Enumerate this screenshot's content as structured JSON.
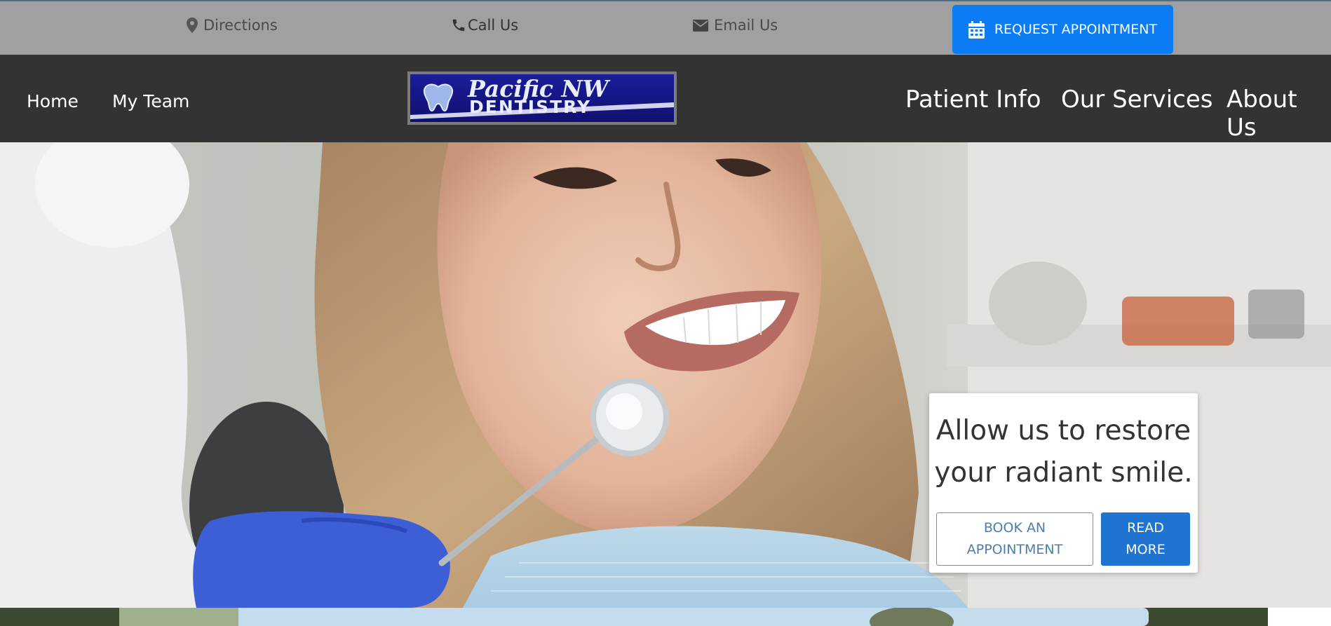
{
  "topbar": {
    "directions_label": "Directions",
    "call_label": "Call Us",
    "email_label": "Email Us",
    "request_label": "REQUEST APPOINTMENT"
  },
  "nav": {
    "home": "Home",
    "team": "My Team",
    "patient_info": "Patient Info",
    "services": "Our Services",
    "about": "About Us"
  },
  "logo": {
    "line1": "Pacific NW",
    "line2": "DENTISTRY"
  },
  "hero": {
    "headline_line1": "Allow us to restore",
    "headline_line2": "your radiant smile.",
    "book_line1": "BOOK AN",
    "book_line2": "APPOINTMENT",
    "read_line1": "READ",
    "read_line2": "MORE"
  },
  "colors": {
    "topbar_bg": "#a0a0a0",
    "navbar_bg": "#333333",
    "accent_blue": "#0b7cf4",
    "read_more_blue": "#1e74d0"
  }
}
